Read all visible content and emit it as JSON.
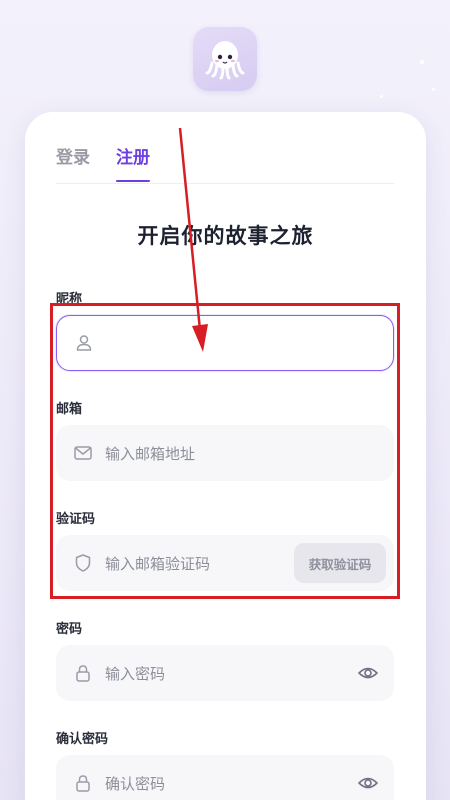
{
  "tabs": {
    "login": "登录",
    "register": "注册"
  },
  "heading": "开启你的故事之旅",
  "fields": {
    "nickname": {
      "label": "昵称",
      "placeholder": "",
      "icon": "user-icon"
    },
    "email": {
      "label": "邮箱",
      "placeholder": "输入邮箱地址",
      "icon": "mail-icon"
    },
    "code": {
      "label": "验证码",
      "placeholder": "输入邮箱验证码",
      "icon": "shield-icon",
      "button": "获取验证码"
    },
    "password": {
      "label": "密码",
      "placeholder": "输入密码",
      "icon": "lock-icon"
    },
    "confirm": {
      "label": "确认密码",
      "placeholder": "确认密码",
      "icon": "lock-icon"
    }
  },
  "colors": {
    "accent": "#6d3fe0",
    "annotation": "#d61e24",
    "field_bg": "#f7f7fa"
  }
}
